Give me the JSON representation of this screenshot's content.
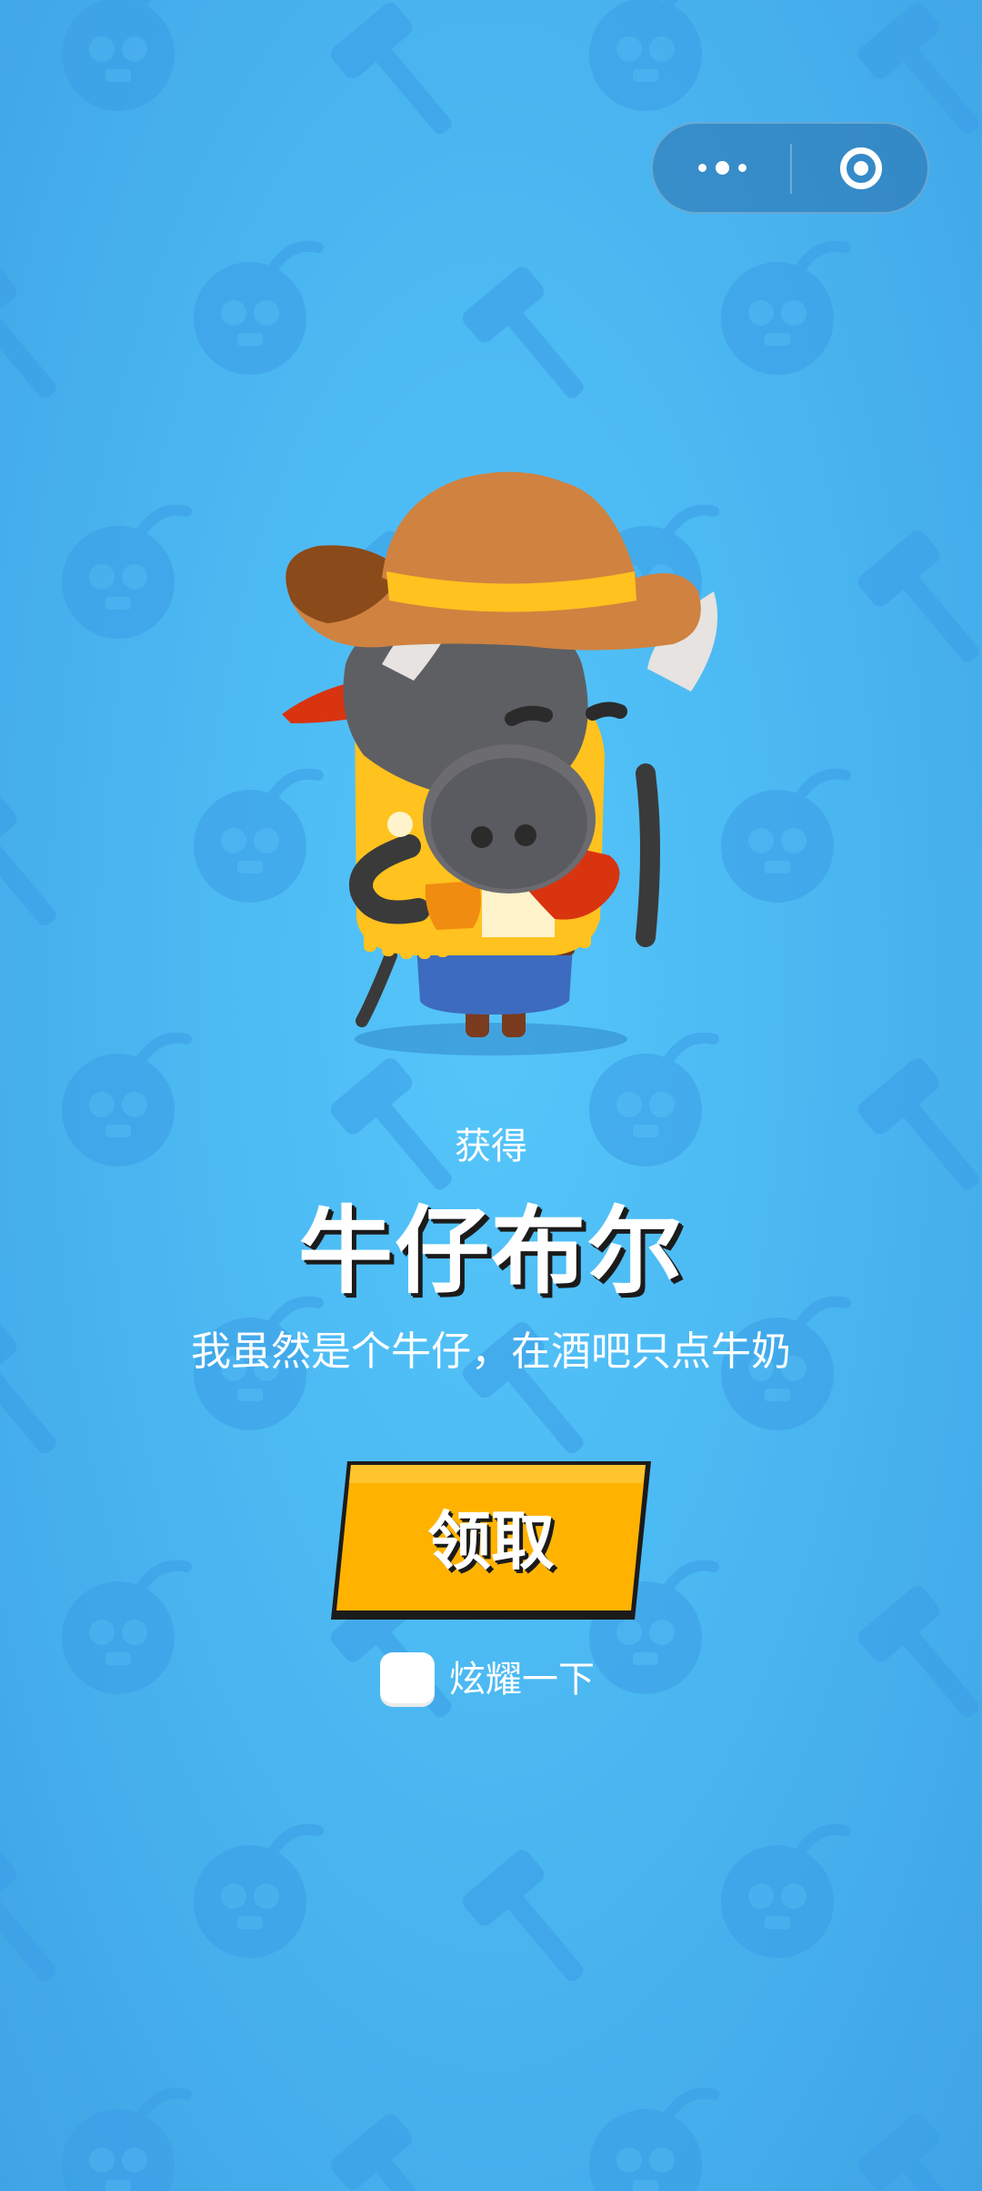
{
  "capsule": {
    "more_icon": "more-dots-icon",
    "close_icon": "target-circle-icon"
  },
  "reward": {
    "get_label": "获得",
    "name": "牛仔布尔",
    "description": "我虽然是个牛仔，在酒吧只点牛奶",
    "character_icon": "cowboy-bull-character"
  },
  "actions": {
    "claim_label": "领取",
    "showoff_label": "炫耀一下",
    "showoff_checked": false
  },
  "colors": {
    "background": "#4bb8f2",
    "button": "#ffb300",
    "button_outline": "#1b1b1b"
  }
}
